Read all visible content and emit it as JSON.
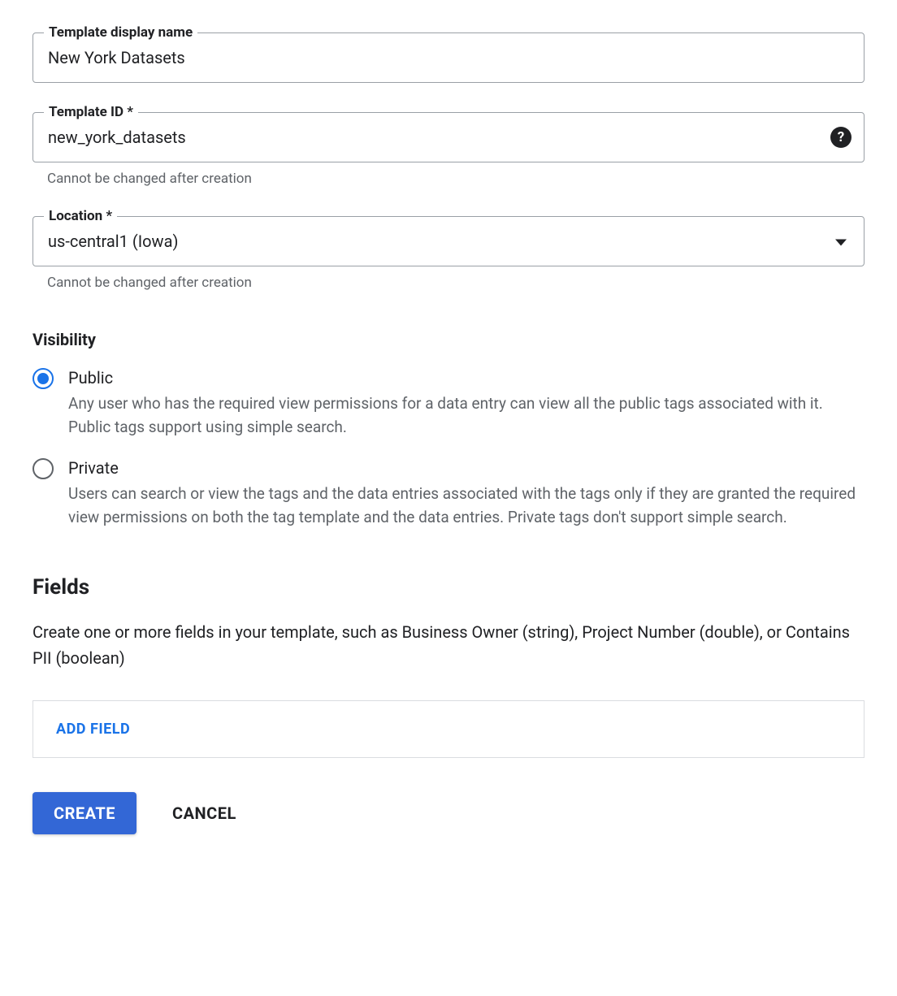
{
  "templateDisplayName": {
    "label": "Template display name",
    "value": "New York Datasets"
  },
  "templateId": {
    "label": "Template ID *",
    "value": "new_york_datasets",
    "helper": "Cannot be changed after creation"
  },
  "location": {
    "label": "Location *",
    "value": "us-central1 (Iowa)",
    "helper": "Cannot be changed after creation"
  },
  "visibility": {
    "heading": "Visibility",
    "options": {
      "public": {
        "label": "Public",
        "description": "Any user who has the required view permissions for a data entry can view all the public tags associated with it. Public tags support using simple search."
      },
      "private": {
        "label": "Private",
        "description": "Users can search or view the tags and the data entries associated with the tags only if they are granted the required view permissions on both the tag template and the data entries. Private tags don't support simple search."
      }
    }
  },
  "fields": {
    "heading": "Fields",
    "description": "Create one or more fields in your template, such as Business Owner (string), Project Number (double), or Contains PII (boolean)",
    "addLabel": "ADD FIELD"
  },
  "actions": {
    "create": "CREATE",
    "cancel": "CANCEL"
  }
}
